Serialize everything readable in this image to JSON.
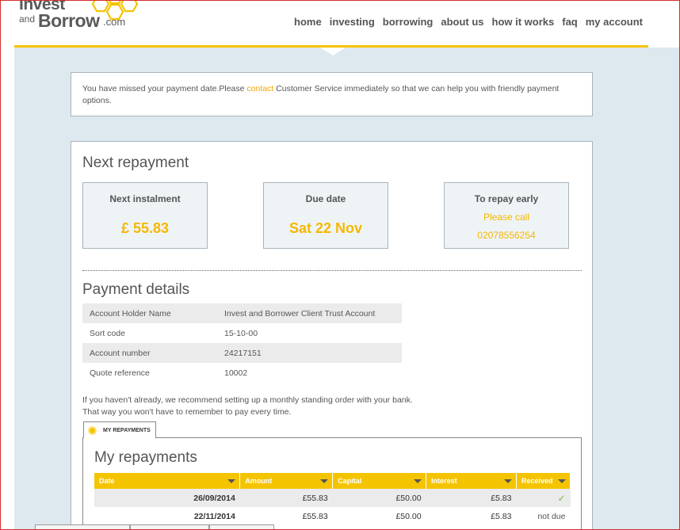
{
  "logo": {
    "invest": "Invest",
    "and": "and",
    "borrow": "Borrow",
    "com": ".com"
  },
  "nav": [
    "home",
    "investing",
    "borrowing",
    "about us",
    "how it works",
    "faq",
    "my account"
  ],
  "alert": {
    "before": "You have missed your payment date.Please ",
    "link": "contact",
    "after": " Customer Service immediately so that we can help you with friendly payment options."
  },
  "next_repayment": {
    "title": "Next repayment",
    "instalment": {
      "label": "Next instalment",
      "value": "£ 55.83"
    },
    "due": {
      "label": "Due date",
      "value": "Sat 22 Nov"
    },
    "early": {
      "label": "To repay early",
      "line1": "Please call",
      "line2": "02078556254"
    }
  },
  "payment_details": {
    "title": "Payment details",
    "rows": [
      {
        "key": "Account Holder Name",
        "value": "Invest and Borrower Client Trust Account"
      },
      {
        "key": "Sort code",
        "value": "15-10-00"
      },
      {
        "key": "Account number",
        "value": "24217151"
      },
      {
        "key": "Quote reference",
        "value": "10002"
      }
    ],
    "advice1": "If you haven't already, we recommend setting up a monthly standing order with your bank.",
    "advice2": "That way you won't have to remember to pay every time."
  },
  "repayments": {
    "tab_label": "MY REPAYMENTS",
    "title": "My repayments",
    "columns": [
      "Date",
      "Amount",
      "Capital",
      "Interest",
      "Received"
    ],
    "rows": [
      {
        "date": "26/09/2014",
        "amount": "£55.83",
        "capital": "£50.00",
        "interest": "£5.83",
        "received": "✓"
      },
      {
        "date": "22/11/2014",
        "amount": "£55.83",
        "capital": "£50.00",
        "interest": "£5.83",
        "received": "not due"
      }
    ]
  },
  "colors": {
    "accent": "#f5c400",
    "text": "#555555",
    "background": "#dde8ef"
  }
}
